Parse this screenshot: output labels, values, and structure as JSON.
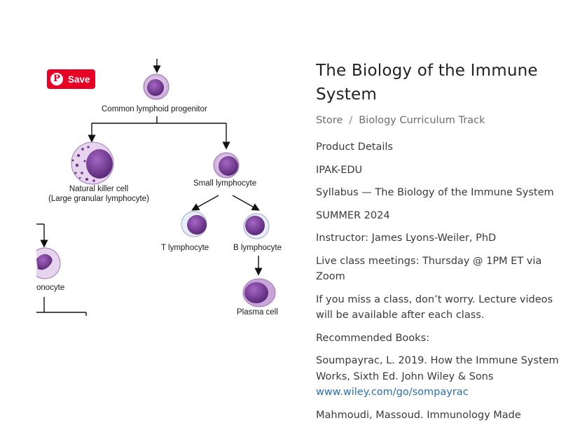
{
  "image": {
    "pinterest_save_label": "Save",
    "pinterest_icon": "pinterest-icon",
    "diagram_labels": {
      "progenitor": "Common lymphoid progenitor",
      "nk_cell_1": "Natural killer cell",
      "nk_cell_2": "(Large granular lymphocyte)",
      "small_lymphocyte": "Small lymphocyte",
      "t_lymphocyte": "T lymphocyte",
      "b_lymphocyte": "B lymphocyte",
      "plasma_cell": "Plasma cell",
      "monocyte_partial": "onocyte"
    }
  },
  "product": {
    "title": "The Biology of the Immune System",
    "breadcrumb": {
      "store": "Store",
      "separator": "/",
      "category": "Biology Curriculum Track"
    },
    "details_heading": "Product Details",
    "code": "IPAK-EDU",
    "syllabus": "Syllabus — The Biology of the Immune System",
    "term": "SUMMER 2024",
    "instructor": "Instructor: James Lyons-Weiler, PhD",
    "live_classes": "Live class meetings: Thursday @ 1PM ET via Zoom",
    "missed_class": "If you miss a class, don’t worry. Lecture videos will be available after each class.",
    "books_heading": "Recommended Books:",
    "book1_text": "Soumpayrac, L. 2019. How the Immune System Works, Sixth Ed. John Wiley & Sons",
    "book1_link": "www.wiley.com/go/sompayrac",
    "book2_text": "Mahmoudi, Massoud. Immunology Made"
  },
  "colors": {
    "pinterest_red": "#e60023",
    "link_blue": "#2a6fb0",
    "cell_purple": "#7a3f9a",
    "cell_light": "#e2cbe9"
  }
}
